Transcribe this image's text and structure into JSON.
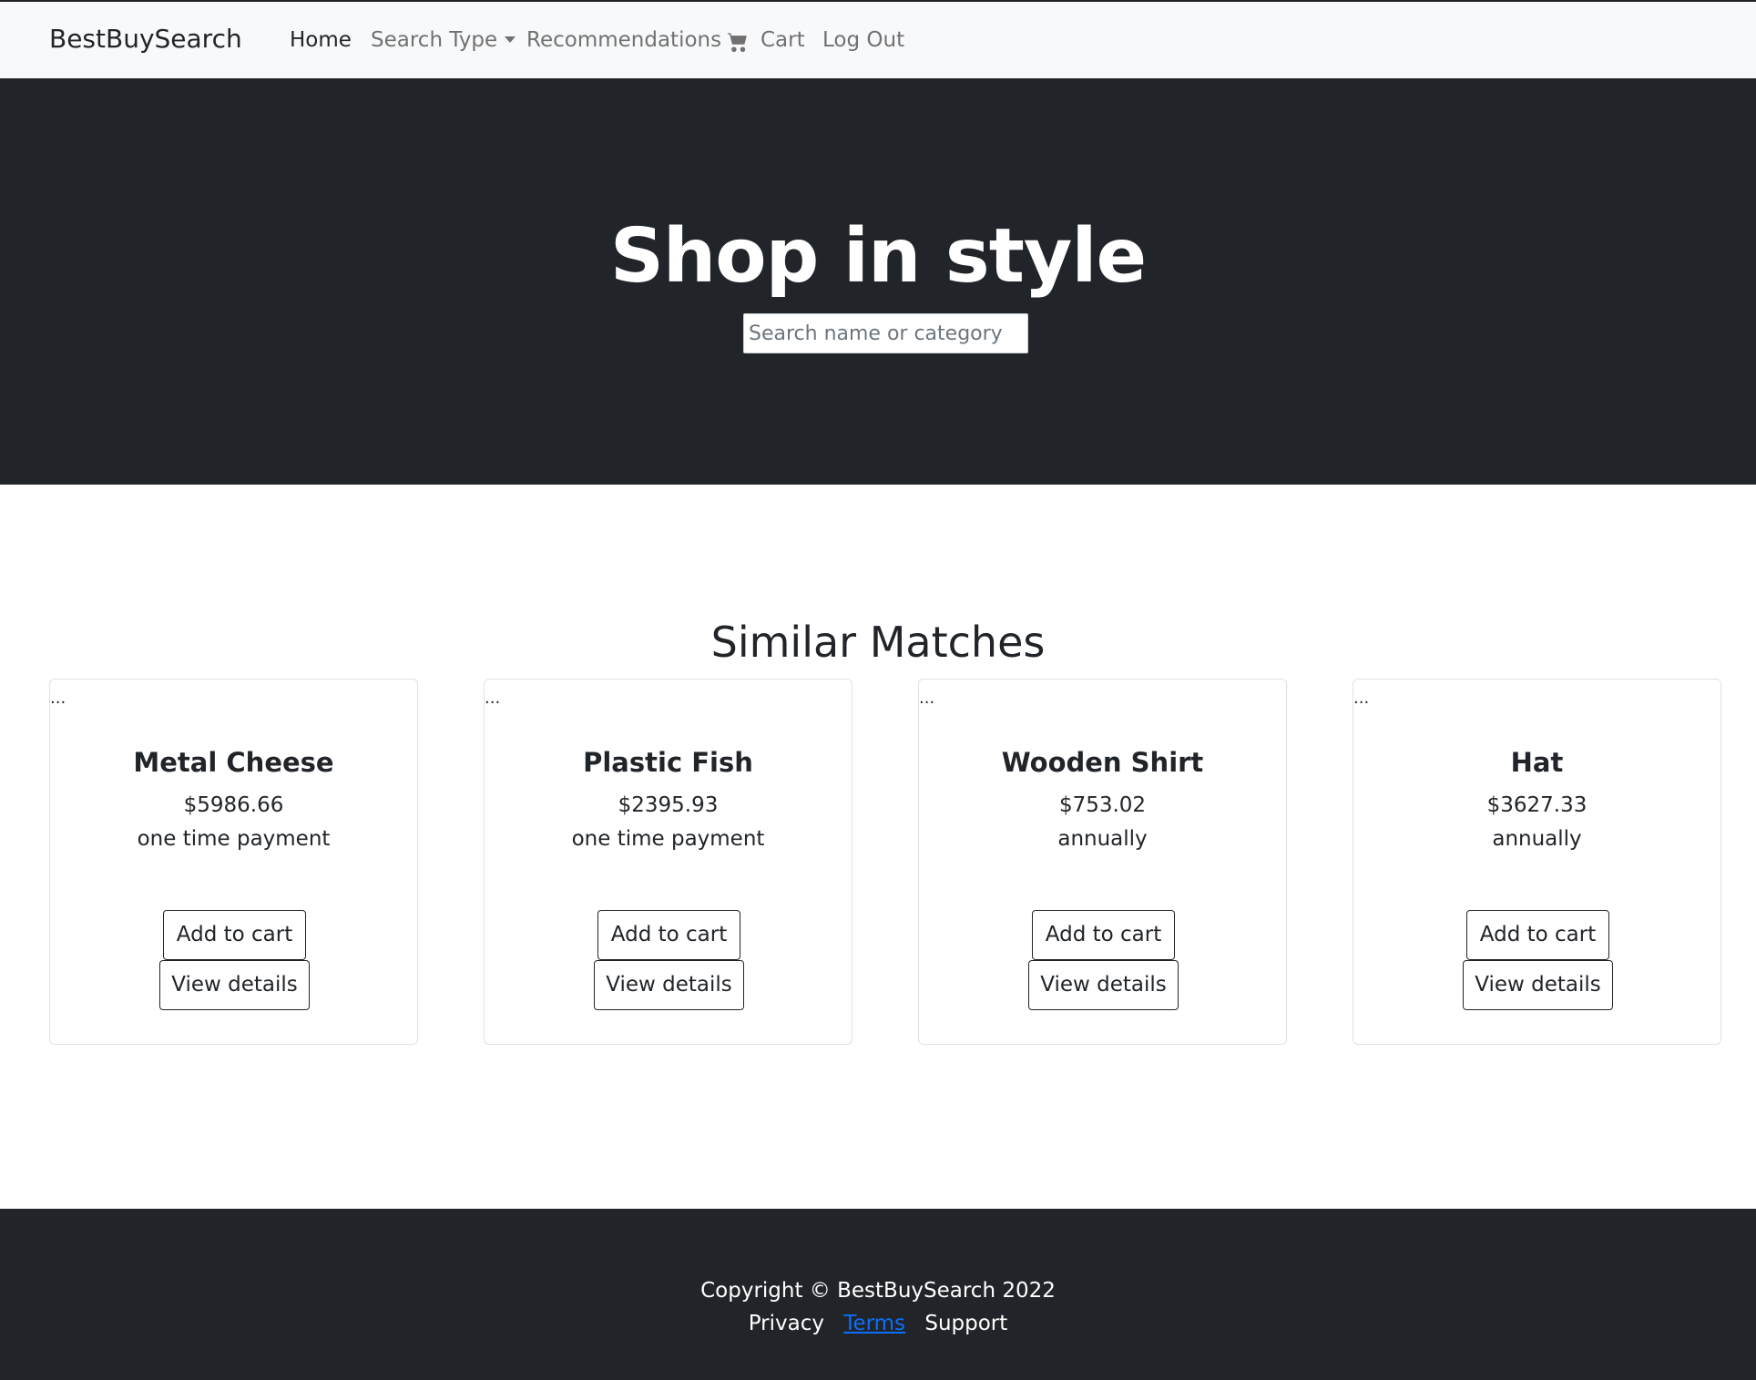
{
  "navbar": {
    "brand": "BestBuySearch",
    "home": "Home",
    "search_type": "Search Type",
    "recommendations": "Recommendations",
    "cart": "Cart",
    "logout": "Log Out",
    "cart_icon": "shopping-cart-icon"
  },
  "hero": {
    "title": "Shop in style",
    "search_placeholder": "Search name or category",
    "search_value": ""
  },
  "matches": {
    "title": "Similar Matches",
    "items": [
      {
        "image_alt": "...",
        "name": "Metal Cheese",
        "price": "$5986.66",
        "term": "one time payment",
        "add_label": "Add to cart",
        "view_label": "View details"
      },
      {
        "image_alt": "...",
        "name": "Plastic Fish",
        "price": "$2395.93",
        "term": "one time payment",
        "add_label": "Add to cart",
        "view_label": "View details"
      },
      {
        "image_alt": "...",
        "name": "Wooden Shirt",
        "price": "$753.02",
        "term": "annually",
        "add_label": "Add to cart",
        "view_label": "View details"
      },
      {
        "image_alt": "...",
        "name": "Hat",
        "price": "$3627.33",
        "term": "annually",
        "add_label": "Add to cart",
        "view_label": "View details"
      }
    ]
  },
  "footer": {
    "copyright": "Copyright © BestBuySearch 2022",
    "privacy": "Privacy",
    "terms": "Terms",
    "support": "Support"
  },
  "colors": {
    "dark": "#212529",
    "navbar_bg": "#f8f9fa",
    "link_blue": "#0d6efd"
  }
}
